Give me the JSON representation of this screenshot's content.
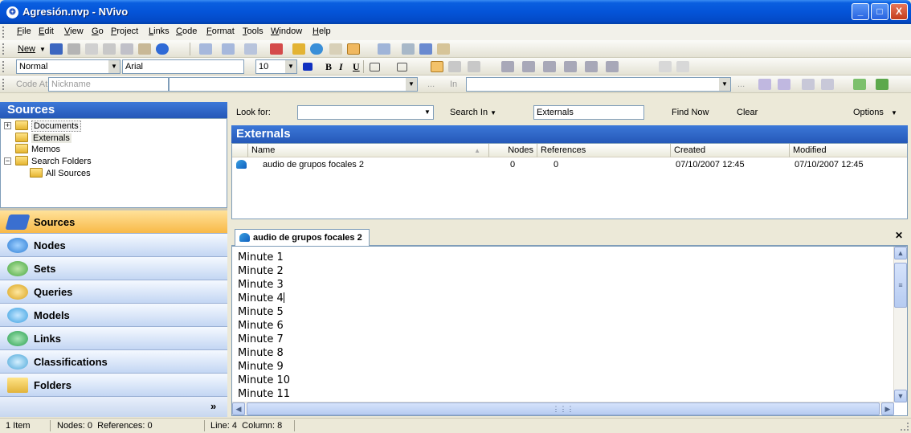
{
  "window": {
    "title": "Agresión.nvp - NVivo",
    "minimize": "_",
    "maximize": "□",
    "close": "X"
  },
  "menu": [
    "File",
    "Edit",
    "View",
    "Go",
    "Project",
    "Links",
    "Code",
    "Format",
    "Tools",
    "Window",
    "Help"
  ],
  "toolbar": {
    "new_label": "New",
    "style_value": "Normal",
    "font_value": "Arial",
    "size_value": "10",
    "bold": "B",
    "italic": "I",
    "underline": "U",
    "code_at": "Code At",
    "nickname": "Nickname",
    "ellipsis": "...",
    "in_label": "In"
  },
  "left": {
    "header": "Sources",
    "tree": [
      {
        "label": "Documents"
      },
      {
        "label": "Externals"
      },
      {
        "label": "Memos"
      },
      {
        "label": "Search Folders"
      },
      {
        "label": "All Sources"
      }
    ],
    "nav": [
      {
        "label": "Sources",
        "icon": "sources-icon",
        "color": "#3a6fd0"
      },
      {
        "label": "Nodes",
        "icon": "nodes-icon",
        "color": "#2f7fd6"
      },
      {
        "label": "Sets",
        "icon": "sets-icon",
        "color": "#47a842"
      },
      {
        "label": "Queries",
        "icon": "queries-icon",
        "color": "#d9a21c"
      },
      {
        "label": "Models",
        "icon": "models-icon",
        "color": "#3aa0e0"
      },
      {
        "label": "Links",
        "icon": "links-icon",
        "color": "#2aa050"
      },
      {
        "label": "Classifications",
        "icon": "classifications-icon",
        "color": "#4aa6d8"
      },
      {
        "label": "Folders",
        "icon": "folders-icon",
        "color": "#e2b33a"
      }
    ],
    "more": "»"
  },
  "find": {
    "look_for": "Look for:",
    "search_in": "Search In",
    "search_in_value": "Externals",
    "find_now": "Find Now",
    "clear": "Clear",
    "options": "Options"
  },
  "externals": {
    "header": "Externals",
    "columns": [
      "Name",
      "Nodes",
      "References",
      "Created",
      "Modified"
    ],
    "rows": [
      {
        "name": "audio de grupos focales 2",
        "nodes": "0",
        "references": "0",
        "created": "07/10/2007 12:45",
        "modified": "07/10/2007 12:45"
      }
    ]
  },
  "document": {
    "tab": "audio de grupos focales 2",
    "lines": [
      "Minute 1",
      "Minute 2",
      "Minute 3",
      "Minute 4",
      "Minute 5",
      "Minute 6",
      "Minute 7",
      "Minute 8",
      "Minute 9",
      "Minute 10",
      "Minute 11"
    ]
  },
  "status": {
    "items": "1 Item",
    "counts": "Nodes: 0  References: 0",
    "position": "Line: 4  Column: 8"
  }
}
